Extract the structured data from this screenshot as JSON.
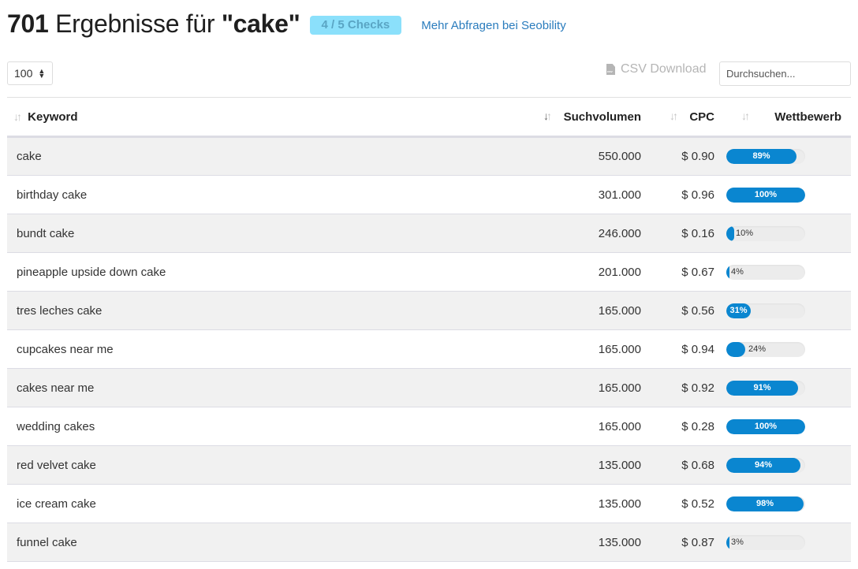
{
  "header": {
    "count": "701",
    "title_text": " Ergebnisse für ",
    "query": "\"cake\"",
    "checks_badge": "4 / 5 Checks",
    "more_link": "Mehr Abfragen bei Seobility"
  },
  "toolbar": {
    "page_length": "100",
    "csv_icon_text": "csv",
    "csv_label": "CSV Download",
    "search_placeholder": "Durchsuchen..."
  },
  "table": {
    "columns": [
      {
        "label": "Keyword",
        "sort_icon": "↓↑"
      },
      {
        "label": "Suchvolumen",
        "sort_icon": "↓↑",
        "active": "desc"
      },
      {
        "label": "CPC",
        "sort_icon": "↓↑"
      },
      {
        "label": "Wettbewerb",
        "sort_icon": "↓↑"
      }
    ],
    "rows": [
      {
        "keyword": "cake",
        "volume": "550.000",
        "cpc": "$ 0.90",
        "competition": 89
      },
      {
        "keyword": "birthday cake",
        "volume": "301.000",
        "cpc": "$ 0.96",
        "competition": 100
      },
      {
        "keyword": "bundt cake",
        "volume": "246.000",
        "cpc": "$ 0.16",
        "competition": 10
      },
      {
        "keyword": "pineapple upside down cake",
        "volume": "201.000",
        "cpc": "$ 0.67",
        "competition": 4
      },
      {
        "keyword": "tres leches cake",
        "volume": "165.000",
        "cpc": "$ 0.56",
        "competition": 31
      },
      {
        "keyword": "cupcakes near me",
        "volume": "165.000",
        "cpc": "$ 0.94",
        "competition": 24
      },
      {
        "keyword": "cakes near me",
        "volume": "165.000",
        "cpc": "$ 0.92",
        "competition": 91
      },
      {
        "keyword": "wedding cakes",
        "volume": "165.000",
        "cpc": "$ 0.28",
        "competition": 100
      },
      {
        "keyword": "red velvet cake",
        "volume": "135.000",
        "cpc": "$ 0.68",
        "competition": 94
      },
      {
        "keyword": "ice cream cake",
        "volume": "135.000",
        "cpc": "$ 0.52",
        "competition": 98
      },
      {
        "keyword": "funnel cake",
        "volume": "135.000",
        "cpc": "$ 0.87",
        "competition": 3
      }
    ]
  },
  "colors": {
    "accent": "#0a86d0",
    "badge_bg": "#8be0fb",
    "link": "#2a7cbd"
  }
}
